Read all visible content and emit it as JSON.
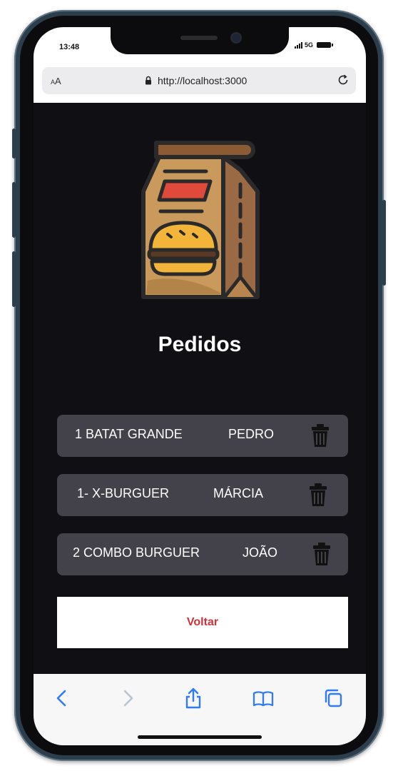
{
  "status_bar": {
    "time": "13:48",
    "network": "5G"
  },
  "browser": {
    "text_size_label": "AA",
    "url": "http://localhost:3000"
  },
  "page": {
    "title": "Pedidos",
    "orders": [
      {
        "item": "1 BATAT GRANDE",
        "name": "PEDRO"
      },
      {
        "item": "1- X-BURGUER",
        "name": "MÁRCIA"
      },
      {
        "item": "2 COMBO BURGUER",
        "name": "JOÃO"
      }
    ],
    "back_button_label": "Voltar"
  },
  "colors": {
    "background": "#0f0f14",
    "card": "#434149",
    "accent": "#d1323c",
    "ios_blue": "#2f7cf6"
  },
  "icons": {
    "logo": "burger-bag-icon",
    "delete": "trash-icon",
    "toolbar": [
      "back-icon",
      "forward-icon",
      "share-icon",
      "bookmarks-icon",
      "tabs-icon"
    ]
  }
}
